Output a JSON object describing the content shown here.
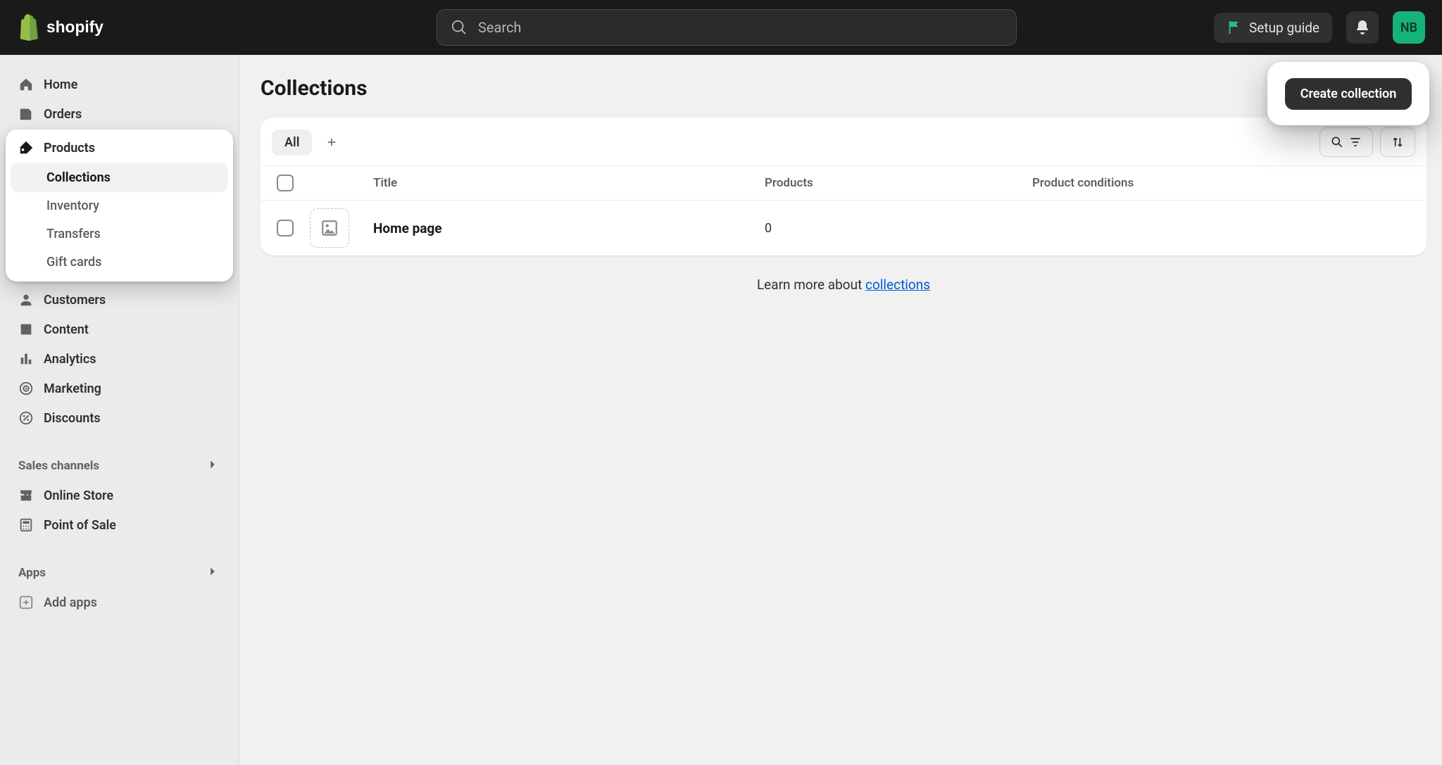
{
  "topbar": {
    "search_placeholder": "Search",
    "setup_guide_label": "Setup guide",
    "avatar_initials": "NB"
  },
  "sidebar": {
    "top": [
      {
        "key": "home",
        "label": "Home"
      },
      {
        "key": "orders",
        "label": "Orders"
      }
    ],
    "products": {
      "label": "Products",
      "children": [
        {
          "key": "collections",
          "label": "Collections",
          "active": true
        },
        {
          "key": "inventory",
          "label": "Inventory"
        },
        {
          "key": "transfers",
          "label": "Transfers"
        },
        {
          "key": "giftcards",
          "label": "Gift cards"
        }
      ]
    },
    "after_products": [
      {
        "key": "customers",
        "label": "Customers"
      },
      {
        "key": "content",
        "label": "Content"
      },
      {
        "key": "analytics",
        "label": "Analytics"
      },
      {
        "key": "marketing",
        "label": "Marketing"
      },
      {
        "key": "discounts",
        "label": "Discounts"
      }
    ],
    "sales_channels": {
      "header": "Sales channels",
      "items": [
        {
          "key": "online_store",
          "label": "Online Store"
        },
        {
          "key": "point_of_sale",
          "label": "Point of Sale"
        }
      ]
    },
    "apps": {
      "header": "Apps",
      "add_apps_label": "Add apps"
    }
  },
  "page": {
    "title": "Collections",
    "create_button": "Create collection",
    "tabs": {
      "all": "All"
    },
    "columns": {
      "title": "Title",
      "products": "Products",
      "conditions": "Product conditions"
    },
    "rows": [
      {
        "title": "Home page",
        "products": "0",
        "conditions": ""
      }
    ],
    "footer": {
      "prefix": "Learn more about ",
      "link_text": "collections"
    }
  }
}
